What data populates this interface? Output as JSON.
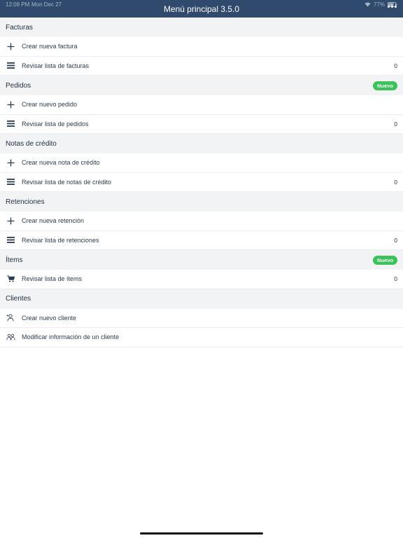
{
  "status_bar": {
    "time": "12:08 PM",
    "date": "Mon Dec 27",
    "battery": "77%"
  },
  "header": {
    "title": "Menú principal 3.5.0"
  },
  "sections": [
    {
      "title": "Facturas",
      "badge": "",
      "items": [
        {
          "icon": "plus-icon",
          "label": "Crear nueva factura",
          "count": ""
        },
        {
          "icon": "list-icon",
          "label": "Revisar lista de facturas",
          "count": "0"
        }
      ]
    },
    {
      "title": "Pedidos",
      "badge": "Nuevo",
      "items": [
        {
          "icon": "plus-icon",
          "label": "Crear nuevo pedido",
          "count": ""
        },
        {
          "icon": "list-icon",
          "label": "Revisar lista de pedidos",
          "count": "0"
        }
      ]
    },
    {
      "title": "Notas de crédito",
      "badge": "",
      "items": [
        {
          "icon": "plus-icon",
          "label": "Crear nueva nota de crédito",
          "count": ""
        },
        {
          "icon": "list-icon",
          "label": "Revisar lista de notas de crédito",
          "count": "0"
        }
      ]
    },
    {
      "title": "Retenciones",
      "badge": "",
      "items": [
        {
          "icon": "plus-icon",
          "label": "Crear nueva retención",
          "count": ""
        },
        {
          "icon": "list-icon",
          "label": "Revisar lista de retenciones",
          "count": "0"
        }
      ]
    },
    {
      "title": "Ítems",
      "badge": "Nuevo",
      "items": [
        {
          "icon": "cart-icon",
          "label": "Revisar lista de ítems",
          "count": "0"
        }
      ]
    },
    {
      "title": "Clientes",
      "badge": "",
      "items": [
        {
          "icon": "add-person-icon",
          "label": "Crear nuevo cliente",
          "count": ""
        },
        {
          "icon": "people-icon",
          "label": "Modificar información de un cliente",
          "count": ""
        }
      ]
    }
  ],
  "colors": {
    "navbar": "#2f4a6c",
    "section_bg": "#f2f3f5",
    "badge": "#3bc25a",
    "text": "#1f2d3d"
  }
}
